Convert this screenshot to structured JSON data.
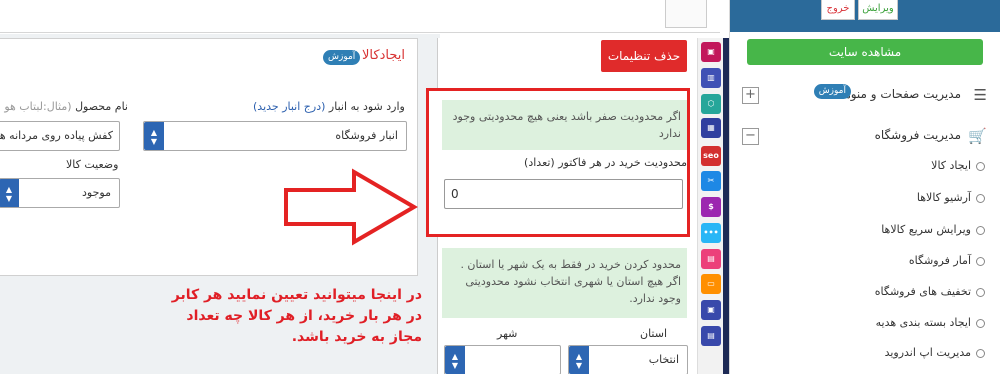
{
  "sidebar": {
    "header_buttons": {
      "edit": "ویرایش",
      "exit": "خروج"
    },
    "view_site": "مشاهده سایت",
    "sections": [
      {
        "label": "مدیریت صفحات و منوها",
        "badge": "آموزش",
        "icon": "list-icon",
        "toggle": "+"
      },
      {
        "label": "مدیریت فروشگاه",
        "icon": "cart-icon",
        "toggle": "−"
      }
    ],
    "items": [
      {
        "label": "ایجاد کالا"
      },
      {
        "label": "آرشیو کالاها"
      },
      {
        "label": "ویرایش سریع کالاها"
      },
      {
        "label": "آمار فروشگاه"
      },
      {
        "label": "تخفیف های فروشگاه"
      },
      {
        "label": "ایجاد بسته بندی هدیه"
      },
      {
        "label": "مدیریت اپ اندروید"
      }
    ]
  },
  "toolbar": {
    "icons": [
      {
        "name": "app-icon",
        "color": "#c2185b",
        "glyph": "▣"
      },
      {
        "name": "chart-icon",
        "color": "#3f51b5",
        "glyph": "▥"
      },
      {
        "name": "hexagon-icon",
        "color": "#26a69a",
        "glyph": "⬡"
      },
      {
        "name": "stats-icon",
        "color": "#303f9f",
        "glyph": "▦"
      },
      {
        "name": "seo-icon",
        "color": "#d32f2f",
        "glyph": "seo"
      },
      {
        "name": "tools-icon",
        "color": "#1e88e5",
        "glyph": "✂"
      },
      {
        "name": "discount-icon",
        "color": "#9c27b0",
        "glyph": "$"
      },
      {
        "name": "more-icon",
        "color": "#29b6f6",
        "glyph": "•••"
      },
      {
        "name": "gallery-icon",
        "color": "#ec407a",
        "glyph": "▤"
      },
      {
        "name": "ticket-icon",
        "color": "#ff8f00",
        "glyph": "▭"
      },
      {
        "name": "layout-icon",
        "color": "#3949ab",
        "glyph": "▣"
      },
      {
        "name": "document-icon",
        "color": "#3949ab",
        "glyph": "▤"
      }
    ]
  },
  "settings": {
    "reset_button": "حذف تنظیمات",
    "hint_zero": "اگر محدودیت صفر باشد یعنی هیچ محدودیتی وجود ندارد",
    "limit_label": "محدودیت خرید در هر فاکتور (تعداد)",
    "limit_value": "0",
    "hint_city": "محدود کردن خرید در فقط به یک شهر یا استان . اگر هیچ استان یا شهری انتخاب نشود محدودیتی وجود ندارد.",
    "province_label": "استان",
    "city_label": "شهر",
    "province_value": "انتخاب",
    "city_value": ""
  },
  "product": {
    "title": "ایجادکالا",
    "tutorial_badge": "آموزش",
    "warehouse_label": "وارد شود به انبار",
    "warehouse_link": "(درج انبار جدید)",
    "warehouse_value": "انبار فروشگاه",
    "name_label": "نام محصول",
    "name_example": "(مثال:لبتاب هو",
    "name_value": "کفش پیاده روی مردانه هو",
    "status_label": "وضعیت کالا",
    "status_value": "موجود"
  },
  "annotation": "در اینجا میتوانید تعیین نمایید هر کابر در هر بار خرید، از هر کالا چه تعداد مجاز به خرید باشد.",
  "colors": {
    "sidebar_header": "#2b6a9a",
    "view_site_button": "#47b649",
    "reset_button": "#e02b2b",
    "highlight_border": "#e42323",
    "hint_background": "#ddf1de",
    "select_arrow": "#2d66b3",
    "annotation_text": "#e01f26"
  }
}
